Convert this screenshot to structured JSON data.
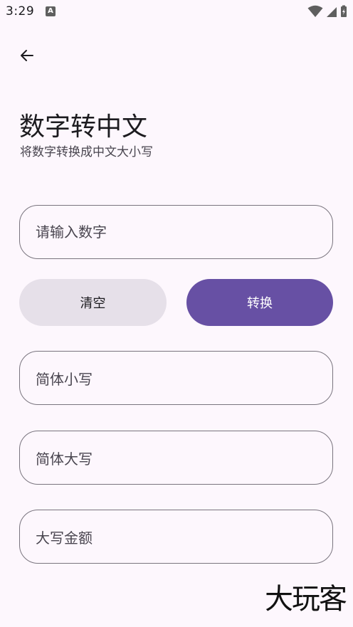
{
  "status_bar": {
    "time": "3:29",
    "notification_letter": "A"
  },
  "header": {
    "title": "数字转中文",
    "subtitle": "将数字转换成中文大小写"
  },
  "input": {
    "placeholder": "请输入数字",
    "value": ""
  },
  "buttons": {
    "clear_label": "清空",
    "convert_label": "转换"
  },
  "outputs": {
    "simplified_lower_label": "简体小写",
    "simplified_upper_label": "简体大写",
    "amount_upper_label": "大写金额"
  },
  "watermark": "大玩客",
  "colors": {
    "background": "#fdf7fd",
    "primary": "#6750a4",
    "secondary_container": "#e6e0e9",
    "outline": "#79747e"
  }
}
